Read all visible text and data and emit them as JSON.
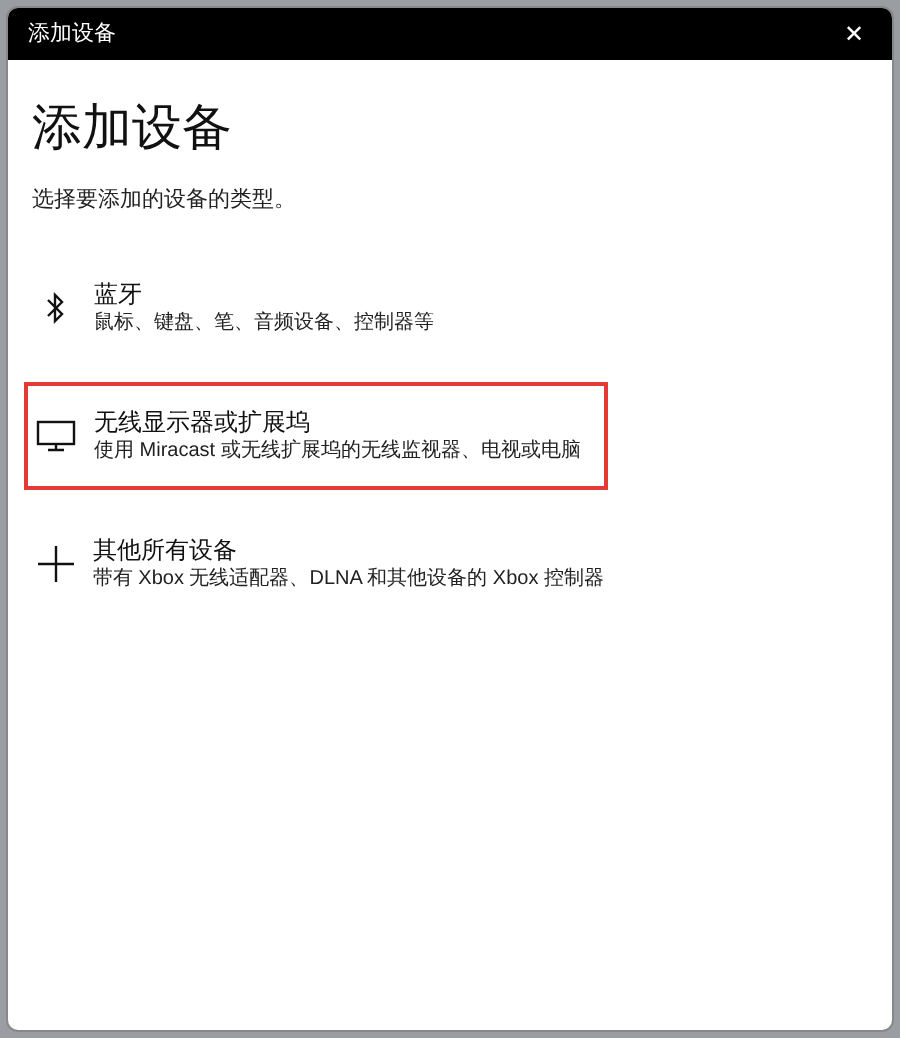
{
  "window": {
    "title": "添加设备",
    "close": "✕"
  },
  "heading": "添加设备",
  "subtitle": "选择要添加的设备的类型。",
  "options": [
    {
      "kind": "bluetooth",
      "title": "蓝牙",
      "description": "鼠标、键盘、笔、音频设备、控制器等",
      "highlighted": false
    },
    {
      "kind": "display",
      "title": "无线显示器或扩展坞",
      "description": "使用 Miracast 或无线扩展坞的无线监视器、电视或电脑",
      "highlighted": true
    },
    {
      "kind": "other",
      "title": "其他所有设备",
      "description": "带有 Xbox 无线适配器、DLNA 和其他设备的 Xbox 控制器",
      "highlighted": false
    }
  ]
}
